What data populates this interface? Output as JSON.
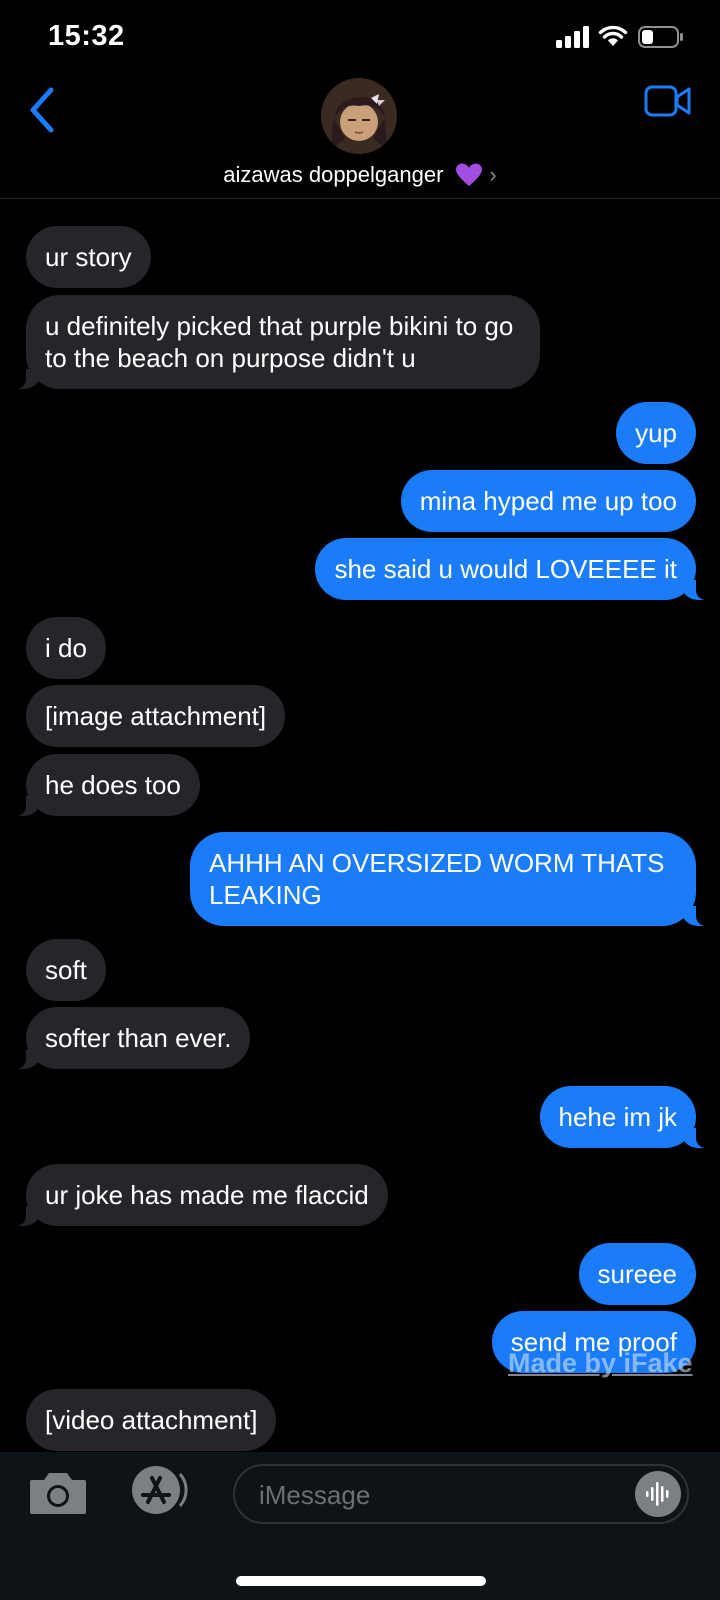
{
  "status_bar": {
    "time": "15:32",
    "icons": [
      "cellular-signal-icon",
      "wifi-icon",
      "battery-icon"
    ]
  },
  "header": {
    "back_icon": "chevron-left-icon",
    "contact_name": "aizawas doppelganger",
    "name_emoji": "purple-heart",
    "detail_chevron": "›",
    "video_icon": "video-camera-icon"
  },
  "messages": [
    {
      "dir": "in",
      "text": "ur story"
    },
    {
      "dir": "in",
      "text": "u definitely picked that purple bikini to go to the beach on purpose didn't u"
    },
    {
      "dir": "out",
      "text": "yup"
    },
    {
      "dir": "out",
      "text": "mina hyped me up too"
    },
    {
      "dir": "out",
      "text": "she said u would LOVEEEE it"
    },
    {
      "dir": "in",
      "text": "i do"
    },
    {
      "dir": "in",
      "text": "[image attachment]"
    },
    {
      "dir": "in",
      "text": "he does too"
    },
    {
      "dir": "out",
      "text": "AHHH AN OVERSIZED WORM THATS LEAKING"
    },
    {
      "dir": "in",
      "text": "soft"
    },
    {
      "dir": "in",
      "text": "softer than ever."
    },
    {
      "dir": "out",
      "text": "hehe im jk"
    },
    {
      "dir": "in",
      "text": "ur joke has made me flaccid"
    },
    {
      "dir": "out",
      "text": "sureee"
    },
    {
      "dir": "out",
      "text": "send me proof"
    },
    {
      "dir": "in",
      "text": "[video attachment]"
    }
  ],
  "watermark": "Made by iFake",
  "input_bar": {
    "placeholder": "iMessage",
    "icons": [
      "camera-icon",
      "app-store-icon",
      "audio-waveform-icon"
    ]
  },
  "colors": {
    "background": "#000000",
    "incoming_bubble": "#26252a",
    "outgoing_bubble": "#1a7cf9",
    "accent": "#1a7cf9"
  }
}
